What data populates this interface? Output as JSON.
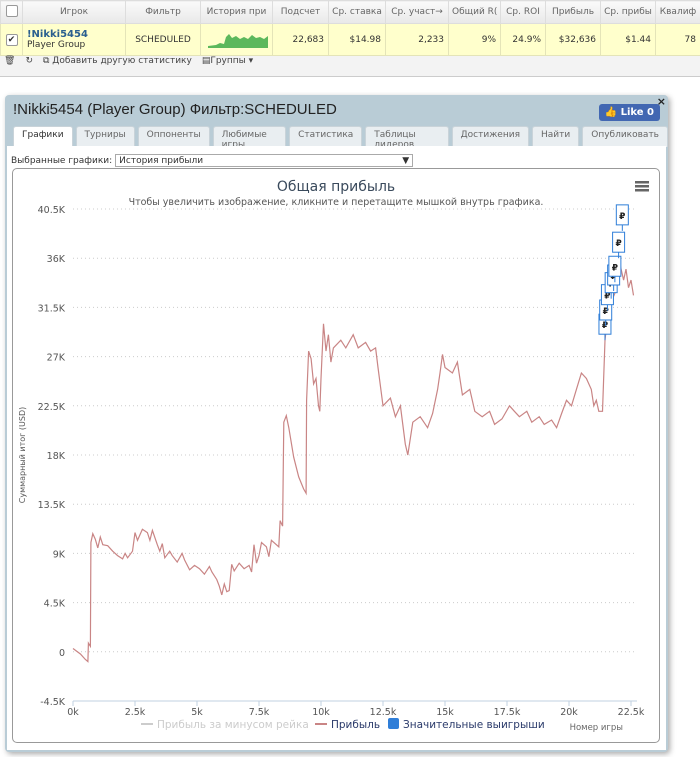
{
  "table": {
    "headers": [
      "Игрок",
      "Фильтр",
      "История при",
      "Подсчет",
      "Ср. ставка",
      "Ср. участ→",
      "Общий R(",
      "Ср. ROI",
      "Прибыль",
      "Ср. прибы",
      "Квалиф"
    ],
    "row": {
      "checked": true,
      "player": "!Nikki5454",
      "group": "Player Group",
      "filter": "SCHEDULED",
      "values": [
        "22,683",
        "$14.98",
        "2,233",
        "9%",
        "24.9%",
        "$32,636",
        "$1.44",
        "78"
      ]
    }
  },
  "toolbar": {
    "add_stat": "Добавить другую статистику",
    "groups": "Группы"
  },
  "dialog": {
    "title": "!Nikki5454 (Player Group) Фильтр:SCHEDULED",
    "like": "Like 0",
    "close": "×",
    "tabs": [
      "Графики",
      "Турниры",
      "Оппоненты",
      "Любимые игры",
      "Статистика",
      "Таблицы лидеров",
      "Достижения",
      "Найти",
      "Опубликовать"
    ],
    "active_tab": 0,
    "selected_label": "Выбранные графики:",
    "selected_value": "История прибыли"
  },
  "colors": {
    "profit": "#c98585",
    "rake": "#cccccc",
    "wins": "#2f7ed8",
    "header": "#b9ccd6",
    "row": "#ffffcc"
  },
  "chart_data": {
    "type": "line",
    "title": "Общая прибыль",
    "subtitle": "Чтобы увеличить изображение, кликните и перетащите мышкой внутрь графика.",
    "xlabel": "Номер игры",
    "ylabel": "Суммарный итог (USD)",
    "xlim": [
      0,
      22500
    ],
    "ylim": [
      -4500,
      40500
    ],
    "xticks": [
      "0k",
      "2.5k",
      "5k",
      "7.5k",
      "10k",
      "12.5k",
      "15k",
      "17.5k",
      "20k",
      "22.5k"
    ],
    "yticks": [
      "40.5K",
      "36K",
      "31.5K",
      "27K",
      "22.5K",
      "18K",
      "13.5K",
      "9K",
      "4.5K",
      "0",
      "-4.5K"
    ],
    "grid": true,
    "legend_position": "bottom",
    "legend": [
      "Прибыль за минусом рейка",
      "Прибыль",
      "Значительные выигрыши"
    ],
    "series": [
      {
        "name": "Прибыль",
        "points": [
          [
            0,
            300
          ],
          [
            300,
            -200
          ],
          [
            500,
            -700
          ],
          [
            600,
            -900
          ],
          [
            620,
            800
          ],
          [
            700,
            500
          ],
          [
            720,
            10000
          ],
          [
            800,
            10800
          ],
          [
            900,
            10300
          ],
          [
            1000,
            9500
          ],
          [
            1100,
            10500
          ],
          [
            1200,
            9800
          ],
          [
            1400,
            9700
          ],
          [
            1600,
            9200
          ],
          [
            1800,
            8800
          ],
          [
            2000,
            8500
          ],
          [
            2100,
            9000
          ],
          [
            2200,
            8600
          ],
          [
            2400,
            9200
          ],
          [
            2500,
            10900
          ],
          [
            2600,
            10200
          ],
          [
            2800,
            11200
          ],
          [
            3000,
            10900
          ],
          [
            3100,
            10200
          ],
          [
            3200,
            11100
          ],
          [
            3400,
            9800
          ],
          [
            3500,
            9200
          ],
          [
            3600,
            9900
          ],
          [
            3700,
            8600
          ],
          [
            3900,
            9200
          ],
          [
            4000,
            8800
          ],
          [
            4200,
            8200
          ],
          [
            4400,
            9000
          ],
          [
            4500,
            8400
          ],
          [
            4700,
            7500
          ],
          [
            4900,
            7900
          ],
          [
            5100,
            7600
          ],
          [
            5300,
            7100
          ],
          [
            5500,
            7800
          ],
          [
            5600,
            7300
          ],
          [
            5800,
            6600
          ],
          [
            5900,
            6000
          ],
          [
            6000,
            5200
          ],
          [
            6100,
            6200
          ],
          [
            6200,
            5500
          ],
          [
            6300,
            5600
          ],
          [
            6400,
            8000
          ],
          [
            6500,
            7400
          ],
          [
            6700,
            8100
          ],
          [
            6900,
            7600
          ],
          [
            7100,
            7900
          ],
          [
            7200,
            7300
          ],
          [
            7300,
            9800
          ],
          [
            7400,
            8100
          ],
          [
            7500,
            8800
          ],
          [
            7600,
            10000
          ],
          [
            7800,
            9600
          ],
          [
            7900,
            8700
          ],
          [
            8000,
            10200
          ],
          [
            8300,
            9600
          ],
          [
            8350,
            12000
          ],
          [
            8450,
            11500
          ],
          [
            8500,
            21000
          ],
          [
            8600,
            21600
          ],
          [
            8700,
            20500
          ],
          [
            8900,
            17800
          ],
          [
            9100,
            16000
          ],
          [
            9300,
            14900
          ],
          [
            9400,
            14500
          ],
          [
            9420,
            23000
          ],
          [
            9500,
            27500
          ],
          [
            9600,
            26800
          ],
          [
            9700,
            24500
          ],
          [
            9800,
            25000
          ],
          [
            9900,
            22500
          ],
          [
            9950,
            22000
          ],
          [
            10000,
            25000
          ],
          [
            10100,
            30000
          ],
          [
            10200,
            27500
          ],
          [
            10300,
            29000
          ],
          [
            10400,
            26500
          ],
          [
            10500,
            27800
          ],
          [
            10800,
            28500
          ],
          [
            11000,
            27800
          ],
          [
            11300,
            29000
          ],
          [
            11500,
            27800
          ],
          [
            11800,
            28300
          ],
          [
            12000,
            27500
          ],
          [
            12200,
            27800
          ],
          [
            12300,
            26000
          ],
          [
            12500,
            22500
          ],
          [
            12800,
            23200
          ],
          [
            13000,
            21500
          ],
          [
            13200,
            22500
          ],
          [
            13400,
            19000
          ],
          [
            13500,
            18000
          ],
          [
            13700,
            21000
          ],
          [
            14000,
            21500
          ],
          [
            14300,
            20500
          ],
          [
            14500,
            21800
          ],
          [
            14700,
            24000
          ],
          [
            14800,
            25500
          ],
          [
            14900,
            27200
          ],
          [
            15000,
            26000
          ],
          [
            15300,
            25500
          ],
          [
            15500,
            26500
          ],
          [
            15700,
            23500
          ],
          [
            16000,
            24000
          ],
          [
            16200,
            22000
          ],
          [
            16500,
            21500
          ],
          [
            16800,
            22000
          ],
          [
            17000,
            20800
          ],
          [
            17300,
            21300
          ],
          [
            17600,
            22500
          ],
          [
            17800,
            22000
          ],
          [
            18000,
            21500
          ],
          [
            18300,
            22000
          ],
          [
            18500,
            21000
          ],
          [
            18800,
            21500
          ],
          [
            19000,
            20800
          ],
          [
            19300,
            21200
          ],
          [
            19500,
            20500
          ],
          [
            19700,
            21800
          ],
          [
            19900,
            23000
          ],
          [
            20100,
            22500
          ],
          [
            20300,
            24000
          ],
          [
            20500,
            25500
          ],
          [
            20700,
            25000
          ],
          [
            20900,
            24000
          ],
          [
            21000,
            22500
          ],
          [
            21100,
            23000
          ],
          [
            21200,
            22000
          ],
          [
            21350,
            22000
          ],
          [
            21450,
            28500
          ],
          [
            21550,
            30500
          ],
          [
            21700,
            32000
          ],
          [
            21850,
            32800
          ],
          [
            22000,
            36000
          ],
          [
            22100,
            35000
          ],
          [
            22200,
            34000
          ],
          [
            22300,
            35000
          ],
          [
            22400,
            33300
          ],
          [
            22500,
            34000
          ],
          [
            22600,
            32600
          ]
        ]
      }
    ],
    "flags": {
      "name": "Значительные выигрыши",
      "symbol": "₽",
      "points": [
        [
          21450,
          28500
        ],
        [
          21480,
          29800
        ],
        [
          21550,
          31200
        ],
        [
          21700,
          32300
        ],
        [
          21800,
          33000
        ],
        [
          21850,
          33800
        ],
        [
          22000,
          36000
        ],
        [
          22150,
          38500
        ]
      ]
    }
  }
}
